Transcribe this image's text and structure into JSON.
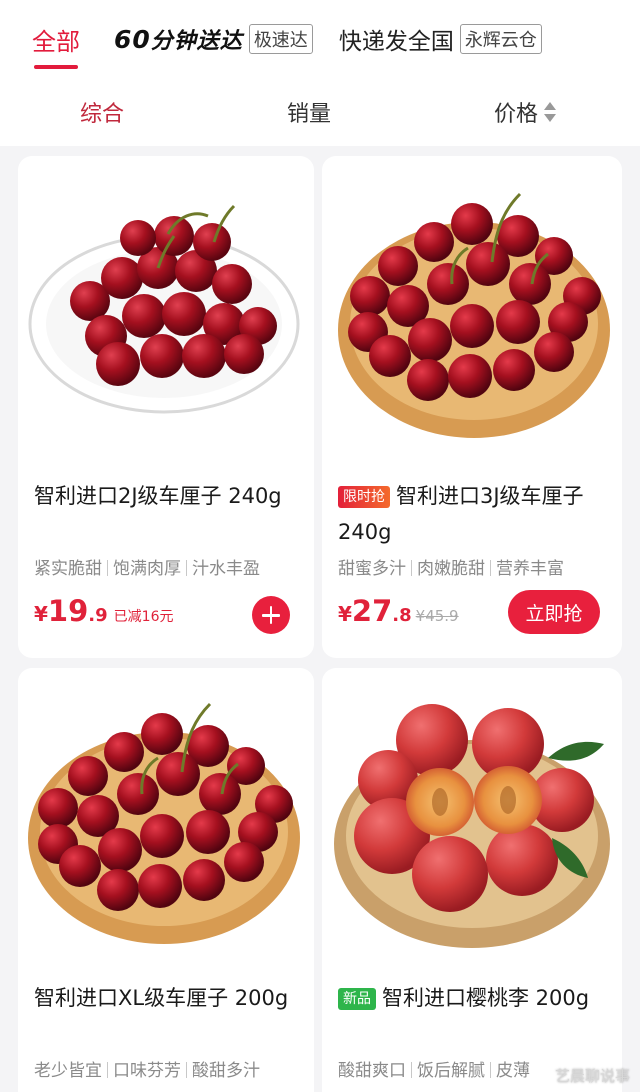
{
  "tabs": {
    "all": "全部",
    "sixty_num": "60",
    "sixty_text": "分钟送达",
    "express_badge": "极速达",
    "national": "快递发全国",
    "warehouse_badge": "永辉云仓"
  },
  "sort": {
    "composite": "综合",
    "sales": "销量",
    "price": "价格"
  },
  "products": [
    {
      "title": "智利进口2J级车厘子 240g",
      "tag": "",
      "features": [
        "紧实脆甜",
        "饱满肉厚",
        "汁水丰盈"
      ],
      "price_yen": "¥",
      "price_int": "19",
      "price_dec": ".9",
      "note": "已减16元",
      "action_icon": "plus-icon"
    },
    {
      "title": "智利进口3J级车厘子 240g",
      "tag": "限时抢",
      "features": [
        "甜蜜多汁",
        "肉嫩脆甜",
        "营养丰富"
      ],
      "price_yen": "¥",
      "price_int": "27",
      "price_dec": ".8",
      "original_price": "¥45.9",
      "action_label": "立即抢"
    },
    {
      "title": "智利进口XL级车厘子 200g",
      "tag": "",
      "features": [
        "老少皆宜",
        "口味芬芳",
        "酸甜多汁"
      ]
    },
    {
      "title": "智利进口樱桃李 200g",
      "tag": "新品",
      "features": [
        "酸甜爽口",
        "饭后解腻",
        "皮薄"
      ]
    }
  ],
  "watermark": "艺晨聊说事",
  "colors": {
    "accent": "#e21b3c",
    "button": "#e8203d",
    "new_tag": "#2eb54b",
    "muted": "#8a8a8a"
  }
}
